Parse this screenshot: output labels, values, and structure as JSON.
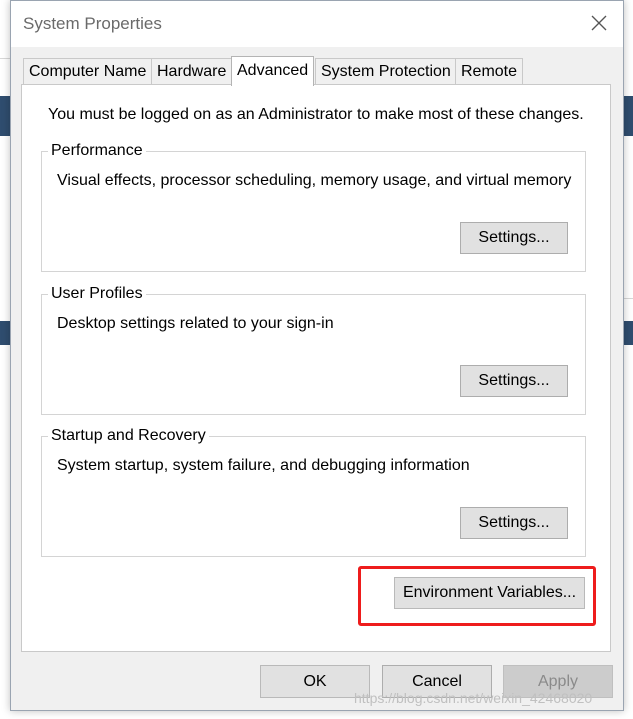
{
  "window": {
    "title": "System Properties"
  },
  "tabs": [
    {
      "label": "Computer Name"
    },
    {
      "label": "Hardware"
    },
    {
      "label": "Advanced",
      "active": true
    },
    {
      "label": "System Protection"
    },
    {
      "label": "Remote"
    }
  ],
  "advanced": {
    "admin_note": "You must be logged on as an Administrator to make most of these changes.",
    "groups": [
      {
        "title": "Performance",
        "description": "Visual effects, processor scheduling, memory usage, and virtual memory",
        "button": "Settings..."
      },
      {
        "title": "User Profiles",
        "description": "Desktop settings related to your sign-in",
        "button": "Settings..."
      },
      {
        "title": "Startup and Recovery",
        "description": "System startup, system failure, and debugging information",
        "button": "Settings..."
      }
    ],
    "env_button": "Environment Variables..."
  },
  "footer": {
    "ok": "OK",
    "cancel": "Cancel",
    "apply": "Apply"
  },
  "watermark": "https://blog.csdn.net/weixin_42468020",
  "colors": {
    "highlight": "#ee1c1c",
    "background_bar": "#2f4d6f"
  },
  "icons": [
    "close-icon"
  ]
}
